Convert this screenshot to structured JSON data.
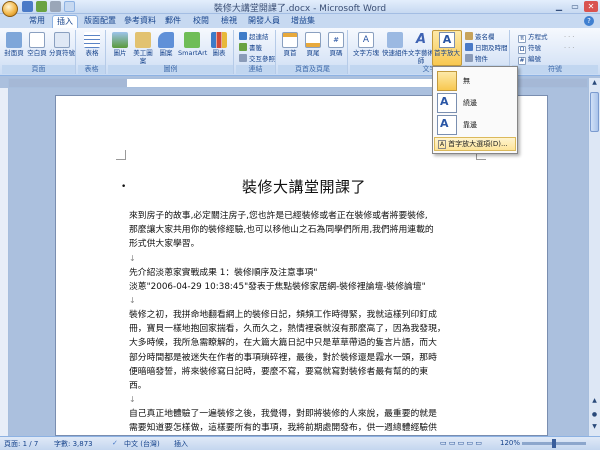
{
  "window": {
    "title": "裝修大講堂開課了.docx - Microsoft Word"
  },
  "tabs": [
    "常用",
    "插入",
    "版面配置",
    "參考資料",
    "郵件",
    "校閱",
    "檢視",
    "開發人員",
    "增益集"
  ],
  "active_tab": "插入",
  "ribbon": {
    "groups": [
      "頁面",
      "表格",
      "圖例",
      "連結",
      "頁首及頁尾",
      "文字",
      "符號"
    ],
    "pages_buttons": [
      "封面頁",
      "空白頁",
      "分頁符號"
    ],
    "table_button": "表格",
    "illustration_buttons": [
      "圖片",
      "美工圖案",
      "圖案",
      "SmartArt",
      "圖表"
    ],
    "link_items": [
      "超連結",
      "書籤",
      "交互參照"
    ],
    "header_buttons": [
      "頁首",
      "頁尾",
      "頁碼"
    ],
    "text_buttons": [
      "文字方塊",
      "快速組件",
      "文字藝術師",
      "首字放大"
    ],
    "text_items": [
      "簽名欄",
      "日期及時間",
      "物件"
    ],
    "equation_items": [
      "方程式",
      "符號",
      "編號"
    ],
    "symbol_label": "符號"
  },
  "dropdown": {
    "button_label": "首字放大",
    "items": [
      "無",
      "繞邊",
      "靠邊"
    ],
    "options_label": "首字放大選項(D)..."
  },
  "document": {
    "title": "裝修大講堂開課了",
    "paragraphs": [
      "來到房子的故事,必定關注房子,您也許是已經裝修或者正在裝修或者將要裝修,",
      "那麼讓大家共用你的裝修經驗,也可以移他山之石為同學們所用,我們將用連載的",
      "形式供大家學習。",
      "",
      "先介紹淡蔥家實戰成果 1：裝修順序及注意事項\"",
      "淡蔥\"2006-04-29 10:38:45\"發表于焦點裝修家居網-裝修裡論壇-裝修論壇\"",
      "",
      "裝修之初，我拼命地翻看網上的裝修日記，頻頻工作時得緊，我就這樣列印釘成",
      "冊，寶貝一樣地抱回家揣看，久而久之，熱情裡衰就沒有那麼高了，因為我發現，",
      "大多時候，我所急需瞭解的，在大篇大篇日記中只是草草帶過的隻言片語，而大",
      "部分時間都是被迷失在作者的事項瑣碎裡，最後，對於裝修還是霧水一頭，那時",
      "便暗暗發誓，將來裝修寫日記時，要麼不寫，要寫就寫對裝修者最有幫的的東",
      "西。",
      "",
      "自己真正地體驗了一遍裝修之後，我覺得，對即將裝修的人來說，最重要的就是",
      "需要知道要怎樣做，這樣要所有的事項，我將前期處開發布，供一週總體經驗供"
    ]
  },
  "status": {
    "page": "頁面: 1 / 7",
    "words": "字數: 3,873",
    "lang": "中文 (台灣)",
    "mode": "插入",
    "zoom": "120%"
  },
  "colors": {
    "accent": "#15428b",
    "ribbon": "#dae6f7",
    "highlight": "#f8c850"
  }
}
